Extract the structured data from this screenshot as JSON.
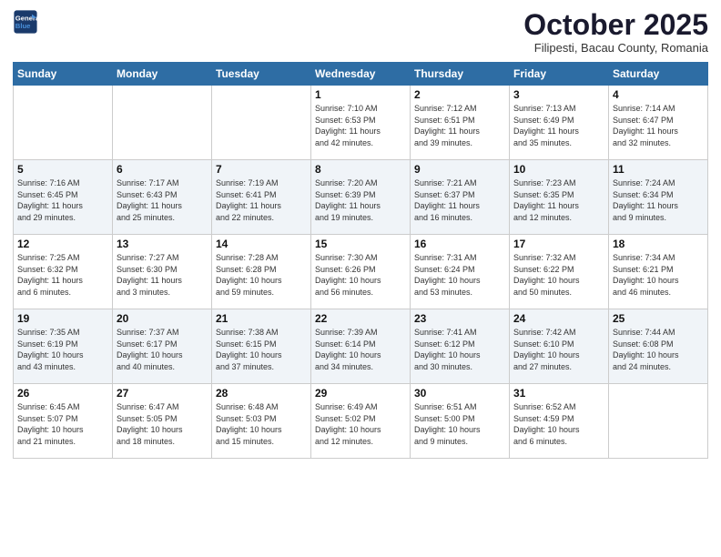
{
  "header": {
    "logo_line1": "General",
    "logo_line2": "Blue",
    "month_title": "October 2025",
    "location": "Filipesti, Bacau County, Romania"
  },
  "weekdays": [
    "Sunday",
    "Monday",
    "Tuesday",
    "Wednesday",
    "Thursday",
    "Friday",
    "Saturday"
  ],
  "weeks": [
    [
      {
        "day": "",
        "info": ""
      },
      {
        "day": "",
        "info": ""
      },
      {
        "day": "",
        "info": ""
      },
      {
        "day": "1",
        "info": "Sunrise: 7:10 AM\nSunset: 6:53 PM\nDaylight: 11 hours\nand 42 minutes."
      },
      {
        "day": "2",
        "info": "Sunrise: 7:12 AM\nSunset: 6:51 PM\nDaylight: 11 hours\nand 39 minutes."
      },
      {
        "day": "3",
        "info": "Sunrise: 7:13 AM\nSunset: 6:49 PM\nDaylight: 11 hours\nand 35 minutes."
      },
      {
        "day": "4",
        "info": "Sunrise: 7:14 AM\nSunset: 6:47 PM\nDaylight: 11 hours\nand 32 minutes."
      }
    ],
    [
      {
        "day": "5",
        "info": "Sunrise: 7:16 AM\nSunset: 6:45 PM\nDaylight: 11 hours\nand 29 minutes."
      },
      {
        "day": "6",
        "info": "Sunrise: 7:17 AM\nSunset: 6:43 PM\nDaylight: 11 hours\nand 25 minutes."
      },
      {
        "day": "7",
        "info": "Sunrise: 7:19 AM\nSunset: 6:41 PM\nDaylight: 11 hours\nand 22 minutes."
      },
      {
        "day": "8",
        "info": "Sunrise: 7:20 AM\nSunset: 6:39 PM\nDaylight: 11 hours\nand 19 minutes."
      },
      {
        "day": "9",
        "info": "Sunrise: 7:21 AM\nSunset: 6:37 PM\nDaylight: 11 hours\nand 16 minutes."
      },
      {
        "day": "10",
        "info": "Sunrise: 7:23 AM\nSunset: 6:35 PM\nDaylight: 11 hours\nand 12 minutes."
      },
      {
        "day": "11",
        "info": "Sunrise: 7:24 AM\nSunset: 6:34 PM\nDaylight: 11 hours\nand 9 minutes."
      }
    ],
    [
      {
        "day": "12",
        "info": "Sunrise: 7:25 AM\nSunset: 6:32 PM\nDaylight: 11 hours\nand 6 minutes."
      },
      {
        "day": "13",
        "info": "Sunrise: 7:27 AM\nSunset: 6:30 PM\nDaylight: 11 hours\nand 3 minutes."
      },
      {
        "day": "14",
        "info": "Sunrise: 7:28 AM\nSunset: 6:28 PM\nDaylight: 10 hours\nand 59 minutes."
      },
      {
        "day": "15",
        "info": "Sunrise: 7:30 AM\nSunset: 6:26 PM\nDaylight: 10 hours\nand 56 minutes."
      },
      {
        "day": "16",
        "info": "Sunrise: 7:31 AM\nSunset: 6:24 PM\nDaylight: 10 hours\nand 53 minutes."
      },
      {
        "day": "17",
        "info": "Sunrise: 7:32 AM\nSunset: 6:22 PM\nDaylight: 10 hours\nand 50 minutes."
      },
      {
        "day": "18",
        "info": "Sunrise: 7:34 AM\nSunset: 6:21 PM\nDaylight: 10 hours\nand 46 minutes."
      }
    ],
    [
      {
        "day": "19",
        "info": "Sunrise: 7:35 AM\nSunset: 6:19 PM\nDaylight: 10 hours\nand 43 minutes."
      },
      {
        "day": "20",
        "info": "Sunrise: 7:37 AM\nSunset: 6:17 PM\nDaylight: 10 hours\nand 40 minutes."
      },
      {
        "day": "21",
        "info": "Sunrise: 7:38 AM\nSunset: 6:15 PM\nDaylight: 10 hours\nand 37 minutes."
      },
      {
        "day": "22",
        "info": "Sunrise: 7:39 AM\nSunset: 6:14 PM\nDaylight: 10 hours\nand 34 minutes."
      },
      {
        "day": "23",
        "info": "Sunrise: 7:41 AM\nSunset: 6:12 PM\nDaylight: 10 hours\nand 30 minutes."
      },
      {
        "day": "24",
        "info": "Sunrise: 7:42 AM\nSunset: 6:10 PM\nDaylight: 10 hours\nand 27 minutes."
      },
      {
        "day": "25",
        "info": "Sunrise: 7:44 AM\nSunset: 6:08 PM\nDaylight: 10 hours\nand 24 minutes."
      }
    ],
    [
      {
        "day": "26",
        "info": "Sunrise: 6:45 AM\nSunset: 5:07 PM\nDaylight: 10 hours\nand 21 minutes."
      },
      {
        "day": "27",
        "info": "Sunrise: 6:47 AM\nSunset: 5:05 PM\nDaylight: 10 hours\nand 18 minutes."
      },
      {
        "day": "28",
        "info": "Sunrise: 6:48 AM\nSunset: 5:03 PM\nDaylight: 10 hours\nand 15 minutes."
      },
      {
        "day": "29",
        "info": "Sunrise: 6:49 AM\nSunset: 5:02 PM\nDaylight: 10 hours\nand 12 minutes."
      },
      {
        "day": "30",
        "info": "Sunrise: 6:51 AM\nSunset: 5:00 PM\nDaylight: 10 hours\nand 9 minutes."
      },
      {
        "day": "31",
        "info": "Sunrise: 6:52 AM\nSunset: 4:59 PM\nDaylight: 10 hours\nand 6 minutes."
      },
      {
        "day": "",
        "info": ""
      }
    ]
  ]
}
